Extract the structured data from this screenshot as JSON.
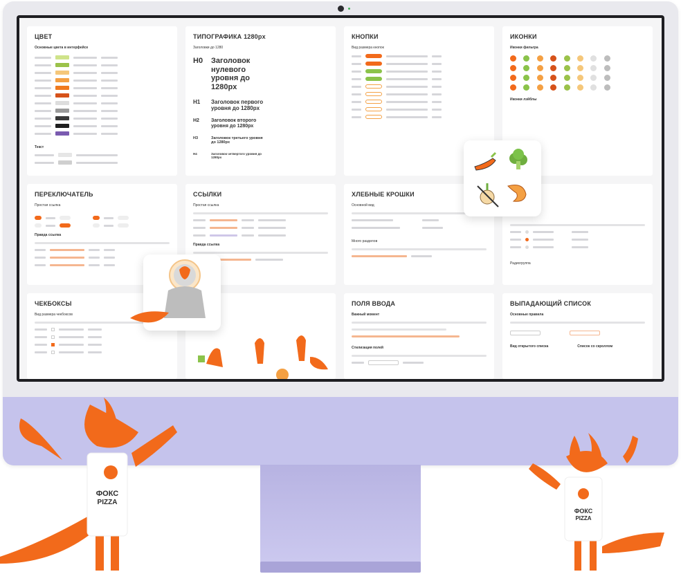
{
  "cards": {
    "color": {
      "title": "ЦВЕТ",
      "subtitle": "Основные цвета в интерфейсе",
      "text_section": "Текст"
    },
    "typography": {
      "title": "ТИПОГРАФИКА 1280px",
      "subtitle": "Заголовки до 1280",
      "headings": [
        {
          "label": "H0",
          "text": "Заголовок нулевого уровня до 1280px"
        },
        {
          "label": "H1",
          "text": "Заголовок первого уровня до 1280px"
        },
        {
          "label": "H2",
          "text": "Заголовок второго уровня до 1280px"
        },
        {
          "label": "H3",
          "text": "Заголовок третьего уровня до 1280px"
        },
        {
          "label": "H4",
          "text": "Заголовок четвертого уровня до 1280px"
        }
      ]
    },
    "buttons": {
      "title": "КНОПКИ",
      "subtitle": "Вид размера кнопок"
    },
    "icons": {
      "title": "ИКОНКИ",
      "subtitle": "Иконки фильтра",
      "subtitle2": "Иконки лэйблы"
    },
    "toggle": {
      "title": "ПЕРЕКЛЮЧАТЕЛЬ",
      "subtitle": "Простая ссылка",
      "subtitle2": "Правда ссылка"
    },
    "links": {
      "title": "ССЫЛКИ",
      "subtitle": "Простая ссылка",
      "subtitle2": "Правда ссылка"
    },
    "breadcrumbs": {
      "title": "ХЛЕБНЫЕ КРОШКИ",
      "subtitle": "Основной вид",
      "subtitle2": "Много разделов"
    },
    "radio": {
      "title": "",
      "subtitle": "Радиогруппа"
    },
    "checkboxes": {
      "title": "ЧЕКБОКСЫ",
      "subtitle": "Вид размера чекбоксов"
    },
    "inputs": {
      "title": "ПОЛЯ ВВОДА",
      "subtitle": "Важный момент",
      "subtitle2": "Стилизация полей"
    },
    "dropdown": {
      "title": "ВЫПАДАЮЩИЙ СПИСОК",
      "subtitle": "Основные правила",
      "subtitle2": "Вид открытого списка",
      "subtitle3": "Список со скроллом"
    }
  },
  "logo_text": "ФОКС PIZZA",
  "colors": {
    "accent": "#f26a1b",
    "green": "#8bc34a",
    "chin": "#c5c3ec",
    "swatches": [
      "#cfe38a",
      "#9bc24a",
      "#f5c77a",
      "#f4a043",
      "#f07a1f",
      "#d6521a",
      "#dddddd",
      "#9a9a9a",
      "#3a3a3a",
      "#1f1f1f",
      "#7a5bb0"
    ]
  }
}
